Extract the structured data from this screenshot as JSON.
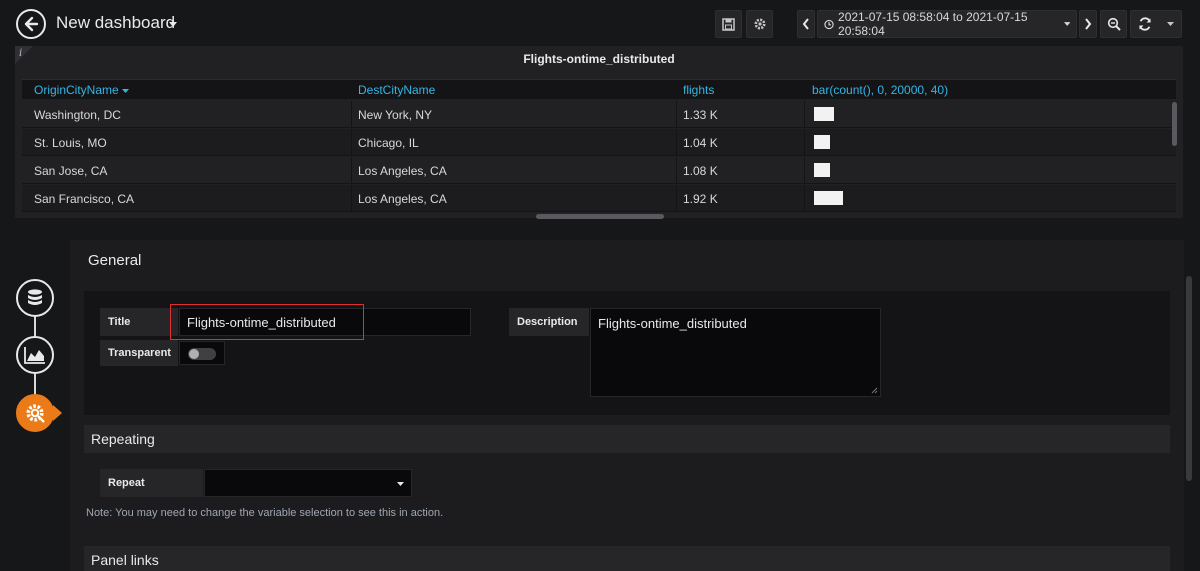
{
  "navbar": {
    "dashboard_title": "New dashboard",
    "time_range": "2021-07-15 08:58:04 to 2021-07-15 20:58:04",
    "icons": [
      "back-arrow-icon",
      "save-icon",
      "gear-icon",
      "chevron-left-icon",
      "clock-icon",
      "chevron-right-icon",
      "zoom-out-icon",
      "refresh-icon"
    ]
  },
  "table_panel": {
    "title": "Flights-ontime_distributed",
    "info_glyph": "i",
    "columns": [
      "OriginCityName",
      "DestCityName",
      "flights",
      "bar(count(), 0, 20000, 40)"
    ],
    "sort_column": "OriginCityName",
    "rows": [
      {
        "origin": "Washington, DC",
        "dest": "New York, NY",
        "flights": "1.33 K",
        "bar_value": 1330
      },
      {
        "origin": "St. Louis, MO",
        "dest": "Chicago, IL",
        "flights": "1.04 K",
        "bar_value": 1040
      },
      {
        "origin": "San Jose, CA",
        "dest": "Los Angeles, CA",
        "flights": "1.08 K",
        "bar_value": 1080
      },
      {
        "origin": "San Francisco, CA",
        "dest": "Los Angeles, CA",
        "flights": "1.92 K",
        "bar_value": 1920
      }
    ],
    "bar_max": 20000
  },
  "editor": {
    "rail": [
      "database-icon",
      "chart-area-icon",
      "gear-cog-icon"
    ],
    "general": {
      "heading": "General",
      "title_label": "Title",
      "title_value": "Flights-ontime_distributed",
      "transparent_label": "Transparent",
      "transparent_on": false,
      "description_label": "Description",
      "description_value": "Flights-ontime_distributed"
    },
    "repeating": {
      "heading": "Repeating",
      "repeat_label": "Repeat",
      "repeat_value": "",
      "note": "Note: You may need to change the variable selection to see this in action."
    },
    "panel_links": {
      "heading": "Panel links"
    }
  },
  "colors": {
    "accent_blue": "#33b5e5",
    "active_orange": "#eb7b18",
    "highlight_red": "#e02f2f"
  }
}
